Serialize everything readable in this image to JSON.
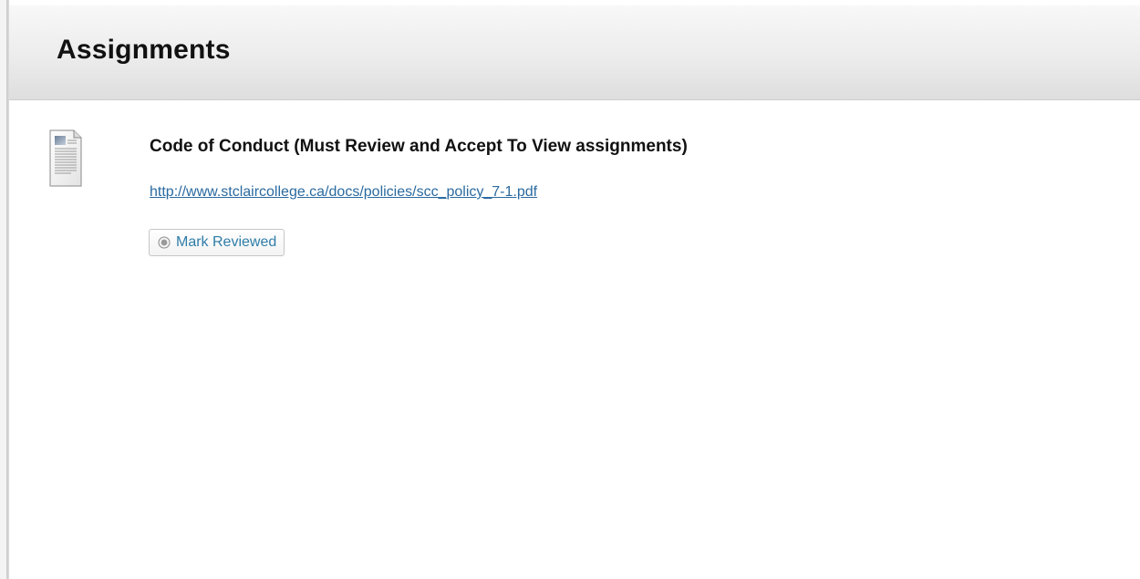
{
  "header": {
    "title": "Assignments"
  },
  "item": {
    "icon": "document-icon",
    "title": "Code of Conduct (Must Review and Accept To View assignments)",
    "link_text": "http://www.stclaircollege.ca/docs/policies/scc_policy_7-1.pdf",
    "mark_reviewed": {
      "icon": "radio-unchecked-icon",
      "label": "Mark Reviewed"
    }
  },
  "colors": {
    "link": "#2a6aa0",
    "button_text": "#2f7da8",
    "header_bg": "#ececec",
    "title_text": "#111111"
  }
}
